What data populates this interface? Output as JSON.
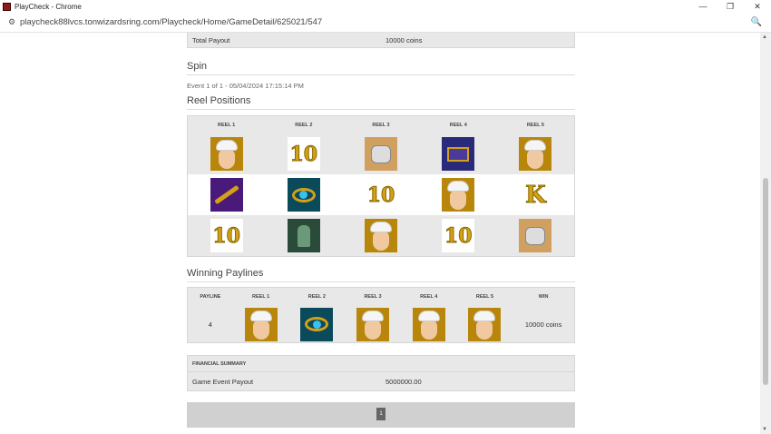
{
  "window": {
    "title": "PlayCheck - Chrome",
    "minimize": "—",
    "restore": "❐",
    "close": "✕"
  },
  "address": {
    "url": "playcheck88lvcs.tonwizardsring.com/Playcheck/Home/GameDetail/625021/547",
    "site_icon": "tune-icon",
    "zoom_icon": "zoom-icon"
  },
  "total_payout": {
    "label": "Total Payout",
    "value": "10000 coins"
  },
  "spin": {
    "title": "Spin",
    "event": "Event 1 of 1 - 05/04/2024 17:15:14 PM"
  },
  "reel_positions": {
    "title": "Reel Positions",
    "headers": [
      "REEL 1",
      "REEL 2",
      "REEL 3",
      "REEL 4",
      "REEL 5"
    ],
    "rows": [
      [
        "genie",
        "ten",
        "elephant",
        "chest",
        "genie"
      ],
      [
        "sword",
        "lamp",
        "ten",
        "genie",
        "king"
      ],
      [
        "ten",
        "cat",
        "genie",
        "ten",
        "elephant"
      ]
    ]
  },
  "winning_paylines": {
    "title": "Winning Paylines",
    "headers": [
      "PAYLINE",
      "REEL 1",
      "REEL 2",
      "REEL 3",
      "REEL 4",
      "REEL 5",
      "WIN"
    ],
    "rows": [
      {
        "payline": "4",
        "symbols": [
          "genie",
          "lamp",
          "genie",
          "genie",
          "genie"
        ],
        "win": "10000 coins"
      }
    ]
  },
  "financial_summary": {
    "title": "FINANCIAL SUMMARY",
    "label": "Game Event Payout",
    "value": "5000000.00"
  },
  "pager": {
    "current_page": "1"
  }
}
